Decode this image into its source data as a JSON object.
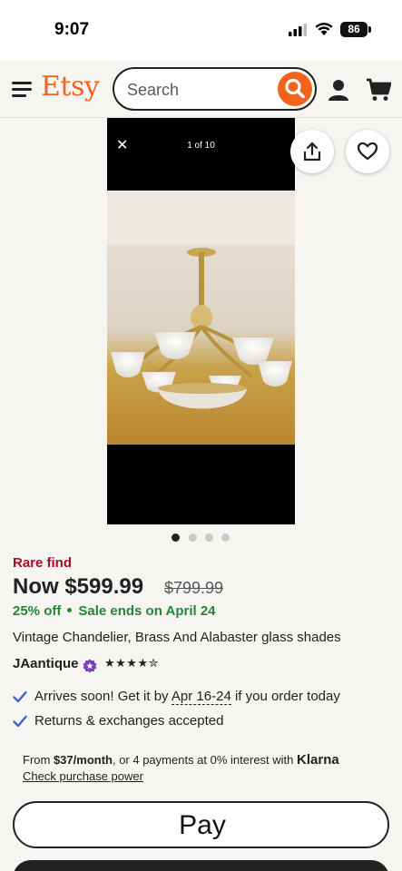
{
  "status_bar": {
    "time": "9:07",
    "battery": "86"
  },
  "header": {
    "logo": "Etsy",
    "search_placeholder": "Search"
  },
  "gallery": {
    "close": "✕",
    "counter": "1 of 10",
    "dot_count": 4,
    "active_dot": 0
  },
  "listing": {
    "badge": "Rare find",
    "price_now": "Now $599.99",
    "price_original": "$799.99",
    "discount": "25% off",
    "sale_end": "Sale ends on April 24",
    "title": "Vintage Chandelier, Brass And Alabaster glass shades",
    "seller": "JAantique",
    "rating_stars": "★★★★✮",
    "rating": 4.5
  },
  "shipping": {
    "arrives_prefix": "Arrives soon! Get it by ",
    "arrives_dates": "Apr 16-24",
    "arrives_suffix": " if you order today",
    "returns": "Returns & exchanges accepted"
  },
  "klarna": {
    "from": "From ",
    "amount": "$37/month",
    "middle": ", or 4 payments at 0% interest with ",
    "brand": "Klarna",
    "link": "Check purchase power"
  },
  "buttons": {
    "apple_glyph": "",
    "apple_pay": "Pay"
  },
  "colors": {
    "brand": "#f1641e",
    "sale_green": "#258635",
    "rare_red": "#b0082b"
  },
  "icons": [
    "hamburger-icon",
    "search-icon",
    "user-icon",
    "cart-icon",
    "close-icon",
    "share-icon",
    "heart-icon",
    "star-seller-icon",
    "check-icon",
    "apple-icon"
  ]
}
